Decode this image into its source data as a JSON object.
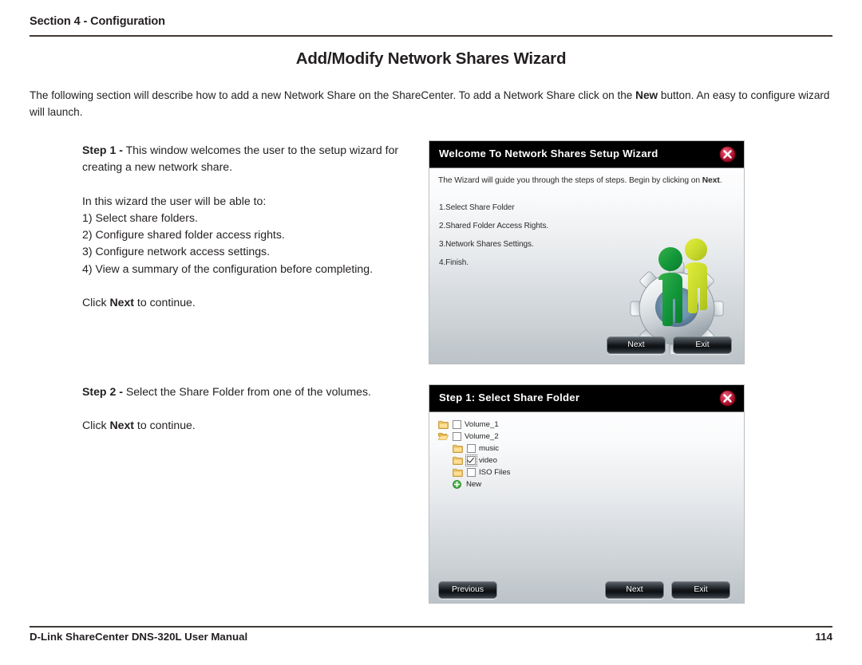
{
  "header": {
    "section": "Section 4 - Configuration"
  },
  "title": "Add/Modify Network Shares Wizard",
  "intro": {
    "part1": "The following section will describe how to add a new Network Share on the ShareCenter. To add a Network Share click on the ",
    "bold1": "New",
    "part2": " button. An easy to configure wizard will launch."
  },
  "step1": {
    "label": "Step 1 -",
    "line1": " This window welcomes the user to the setup wizard for creating a new network share.",
    "line2": "In this wizard the user will be able to:",
    "items": [
      "1) Select share folders.",
      "2) Configure shared folder access rights.",
      "3) Configure network access settings.",
      "4) View a summary of the configuration before completing."
    ],
    "click_pre": "Click ",
    "click_bold": "Next",
    "click_post": " to continue."
  },
  "step2": {
    "label": "Step 2 -",
    "line1": " Select the Share Folder from one of the volumes.",
    "click_pre": "Click ",
    "click_bold": "Next",
    "click_post": " to continue."
  },
  "dialog_welcome": {
    "title": "Welcome To Network Shares Setup Wizard",
    "close_icon": "close-icon",
    "intro_pre": "The Wizard will guide you through the steps of steps. Begin by clicking on ",
    "intro_bold": "Next",
    "intro_post": ".",
    "steps": [
      "1.Select Share Folder",
      "2.Shared Folder Access Rights.",
      "3.Network Shares Settings.",
      "4.Finish."
    ],
    "illustration": "gear-with-users-icon",
    "buttons": {
      "next": "Next",
      "exit": "Exit"
    }
  },
  "dialog_select": {
    "title": "Step 1: Select Share Folder",
    "close_icon": "close-icon",
    "tree": [
      {
        "label": "Volume_1",
        "icon": "folder-closed-icon",
        "checked": false,
        "indent": false,
        "type": "folder"
      },
      {
        "label": "Volume_2",
        "icon": "folder-open-icon",
        "checked": false,
        "indent": false,
        "type": "folder"
      },
      {
        "label": "music",
        "icon": "folder-closed-icon",
        "checked": false,
        "indent": true,
        "type": "folder"
      },
      {
        "label": "video",
        "icon": "folder-closed-icon",
        "checked": true,
        "indent": true,
        "type": "folder"
      },
      {
        "label": "ISO Files",
        "icon": "folder-closed-icon",
        "checked": false,
        "indent": true,
        "type": "folder"
      },
      {
        "label": "New",
        "icon": "add-new-icon",
        "checked": false,
        "indent": true,
        "type": "action"
      }
    ],
    "buttons": {
      "previous": "Previous",
      "next": "Next",
      "exit": "Exit"
    }
  },
  "footer": {
    "left": "D-Link ShareCenter DNS-320L User Manual",
    "page": "114"
  },
  "colors": {
    "rule": "#3f3a37",
    "titlebar": "#000000",
    "close_red": "#b5132a",
    "folder_yellow": "#f0c060",
    "person_green_dark": "#1f9a3c",
    "person_green_light": "#c4d82e"
  }
}
